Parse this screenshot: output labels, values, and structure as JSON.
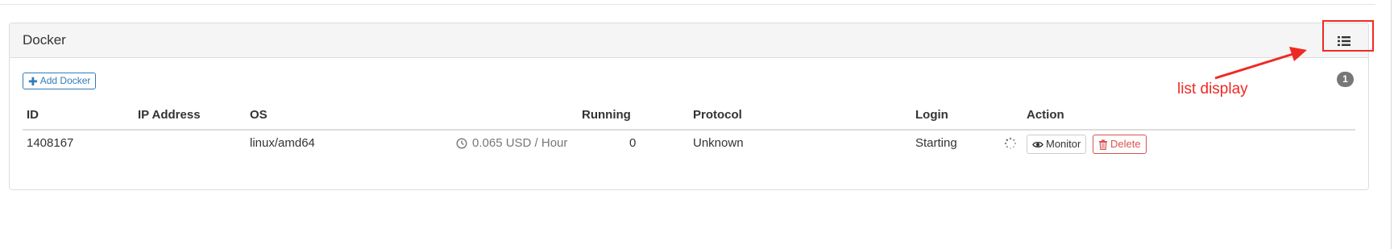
{
  "panel": {
    "title": "Docker"
  },
  "toolbar": {
    "add_label": "Add Docker",
    "count_badge": "1"
  },
  "annotation": {
    "label": "list display",
    "color": "#ee2a24"
  },
  "table": {
    "headers": [
      "ID",
      "IP Address",
      "OS",
      "Running",
      "Protocol",
      "Login",
      "Action"
    ],
    "rows": [
      {
        "id": "1408167",
        "ip_address": "",
        "os": "linux/amd64",
        "price": "0.065 USD / Hour",
        "running": "0",
        "protocol": "Unknown",
        "login": "Starting",
        "actions": {
          "monitor": "Monitor",
          "delete": "Delete"
        }
      }
    ]
  },
  "icons": {
    "list_toggle": "list-icon",
    "add": "plus-icon",
    "price": "clock-icon",
    "login_status": "spinner-icon",
    "monitor": "eye-icon",
    "delete": "trash-icon"
  },
  "colors": {
    "primary": "#337ab7",
    "danger": "#d9534f",
    "badge": "#777777"
  }
}
